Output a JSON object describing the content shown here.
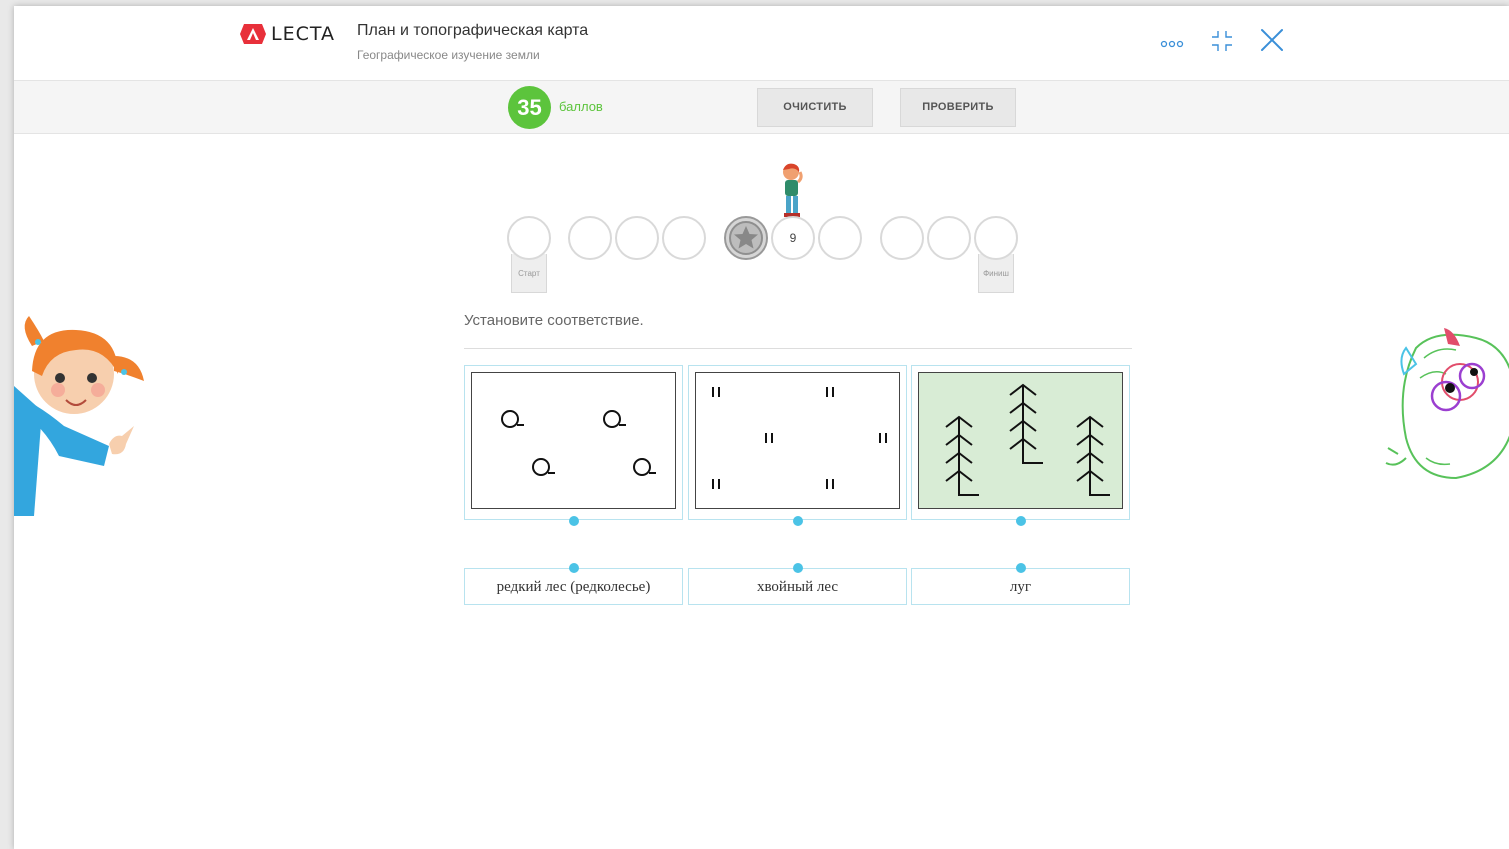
{
  "app": {
    "logo_text": "LECTA",
    "title": "План и топографическая карта",
    "subtitle": "Географическое изучение земли"
  },
  "header_icons": [
    "more-icon",
    "collapse-icon",
    "close-icon"
  ],
  "toolbar": {
    "score": "35",
    "score_label": "баллов",
    "clear_label": "ОЧИСТИТЬ",
    "check_label": "ПРОВЕРИТЬ"
  },
  "progress": {
    "start_label": "Старт",
    "finish_label": "Финиш",
    "current_number": "9"
  },
  "task": {
    "instruction": "Установите соответствие."
  },
  "answers": [
    {
      "label": "редкий лес (редколесье)"
    },
    {
      "label": "хвойный лес"
    },
    {
      "label": "луг"
    }
  ],
  "colors": {
    "score_green": "#5cc43c",
    "accent_blue": "#4bc3e6",
    "meadow_fill": "#d8ecd5",
    "logo_red": "#e8303a"
  }
}
